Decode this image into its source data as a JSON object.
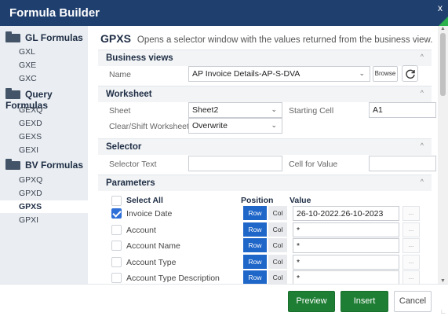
{
  "window": {
    "title": "Formula Builder",
    "close_label": "x"
  },
  "sidebar": {
    "groups": [
      {
        "label": "GL Formulas",
        "items": [
          "GXL",
          "GXE",
          "GXC"
        ]
      },
      {
        "label": "Query Formulas",
        "items": [
          "GEXQ",
          "GEXD",
          "GEXS",
          "GEXI"
        ]
      },
      {
        "label": "BV Formulas",
        "items": [
          "GPXQ",
          "GPXD",
          "GPXS",
          "GPXI"
        ]
      }
    ],
    "active_item": "GPXS"
  },
  "main": {
    "code": "GPXS",
    "description": "Opens a selector window with the values returned from the business view.",
    "business_views": {
      "title": "Business views",
      "name_label": "Name",
      "name_value": "AP Invoice Details-AP-S-DVA",
      "browse_label": "Browse"
    },
    "worksheet": {
      "title": "Worksheet",
      "sheet_label": "Sheet",
      "sheet_value": "Sheet2",
      "starting_cell_label": "Starting Cell",
      "starting_cell_value": "A1",
      "clear_label": "Clear/Shift Worksheet",
      "clear_value": "Overwrite"
    },
    "selector": {
      "title": "Selector",
      "selector_text_label": "Selector Text",
      "selector_text_value": "",
      "cell_for_value_label": "Cell for Value",
      "cell_for_value_value": ""
    },
    "parameters": {
      "title": "Parameters",
      "select_all_label": "Select All",
      "position_header": "Position",
      "value_header": "Value",
      "row_label": "Row",
      "col_label": "Col",
      "dots_label": "...",
      "rows": [
        {
          "name": "Invoice Date",
          "checked": true,
          "value": "26-10-2022.26-10-2023"
        },
        {
          "name": "Account",
          "checked": false,
          "value": "*"
        },
        {
          "name": "Account Name",
          "checked": false,
          "value": "*"
        },
        {
          "name": "Account Type",
          "checked": false,
          "value": "*"
        },
        {
          "name": "Account Type Description",
          "checked": false,
          "value": "*"
        }
      ]
    }
  },
  "footer": {
    "preview_label": "Preview",
    "insert_label": "Insert",
    "cancel_label": "Cancel"
  },
  "colors": {
    "titlebar": "#1f3f6e",
    "accent_green": "#1e7e34",
    "row_button": "#1f66c9",
    "checkbox": "#2e6fd8"
  }
}
